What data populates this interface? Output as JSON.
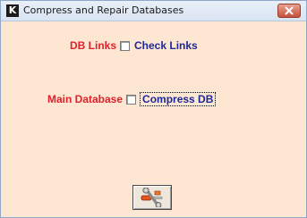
{
  "window": {
    "title": "Compress and Repair Databases",
    "icon_glyph": "K"
  },
  "options": {
    "db_links": {
      "label": "DB Links",
      "checkbox_label": "Check Links",
      "checked": false
    },
    "main_database": {
      "label": "Main Database",
      "checkbox_label": "Compress DB",
      "checked": false
    }
  },
  "icons": {
    "app": "app-k-icon",
    "close": "close-icon",
    "run": "tools-icon"
  },
  "colors": {
    "background": "#fde6d2",
    "label_red": "#e0202a",
    "label_blue": "#1d2a9a"
  }
}
